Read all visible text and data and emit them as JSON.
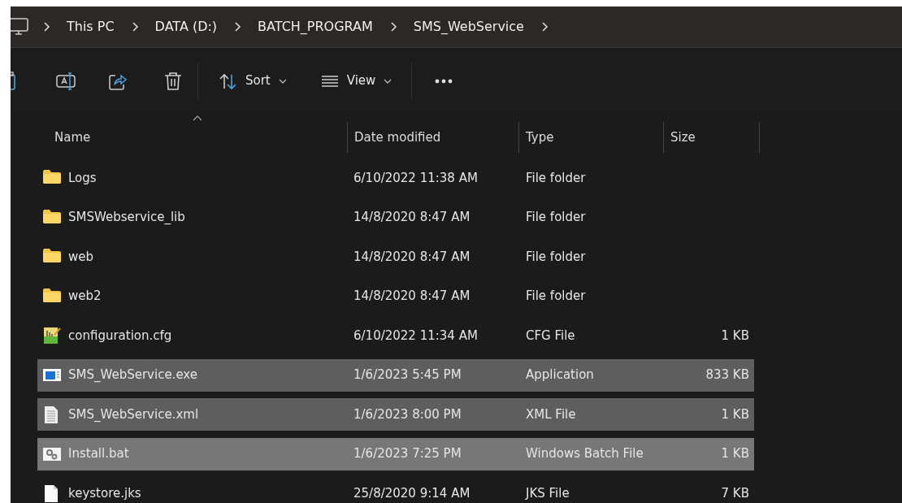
{
  "breadcrumb": [
    "This PC",
    "DATA (D:)",
    "BATCH_PROGRAM",
    "SMS_WebService"
  ],
  "toolbar": [
    {
      "kind": "copy"
    },
    {
      "kind": "rename"
    },
    {
      "kind": "share"
    },
    {
      "kind": "delete"
    },
    {
      "kind": "separator"
    },
    {
      "kind": "sort",
      "label": "Sort"
    },
    {
      "kind": "view",
      "label": "View"
    },
    {
      "kind": "separator"
    },
    {
      "kind": "more"
    }
  ],
  "columns": [
    {
      "label": "Name",
      "sorted": true
    },
    {
      "label": "Date modified",
      "sorted": false
    },
    {
      "label": "Type",
      "sorted": false
    },
    {
      "label": "Size",
      "sorted": false
    }
  ],
  "rows": [
    {
      "name": "Logs",
      "kind": "folder",
      "date": "6/10/2022 11:38 AM",
      "type": "File folder",
      "selected": false,
      "hovered": false
    },
    {
      "name": "SMSWebservice_lib",
      "kind": "folder",
      "date": "14/8/2020 8:47 AM",
      "type": "File folder",
      "selected": false,
      "hovered": false
    },
    {
      "name": "web",
      "kind": "folder",
      "date": "14/8/2020 8:47 AM",
      "type": "File folder",
      "selected": false,
      "hovered": false
    },
    {
      "name": "web2",
      "kind": "folder",
      "date": "14/8/2020 8:47 AM",
      "type": "File folder",
      "selected": false,
      "hovered": false
    },
    {
      "name": "configuration.cfg",
      "kind": "cfg",
      "date": "6/10/2022 11:34 AM",
      "type": "CFG File",
      "size": "1 KB",
      "selected": false,
      "hovered": false
    },
    {
      "name": "SMS_WebService.exe",
      "kind": "exe",
      "date": "1/6/2023 5:45 PM",
      "type": "Application",
      "size": "833 KB",
      "selected": true,
      "hovered": false
    },
    {
      "name": "SMS_WebService.xml",
      "kind": "xml",
      "date": "1/6/2023 8:00 PM",
      "type": "XML File",
      "size": "1 KB",
      "selected": true,
      "hovered": false
    },
    {
      "name": "Install.bat",
      "kind": "bat",
      "date": "1/6/2023 7:25 PM",
      "type": "Windows Batch File",
      "size": "1 KB",
      "selected": true,
      "hovered": true
    },
    {
      "name": "keystore.jks",
      "kind": "jks",
      "date": "25/8/2020 9:14 AM",
      "type": "JKS File",
      "size": "7 KB",
      "selected": false,
      "hovered": false
    }
  ]
}
